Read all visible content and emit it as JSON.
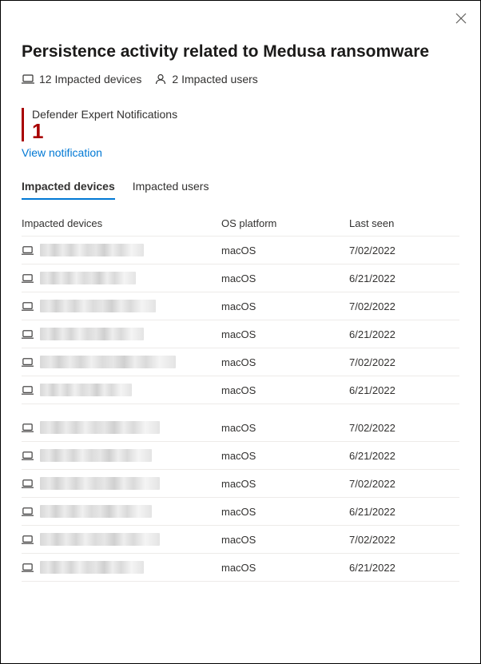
{
  "title": "Persistence activity related to Medusa ransomware",
  "summary": {
    "devices_label": "12 Impacted devices",
    "users_label": "2 Impacted users"
  },
  "notification": {
    "label": "Defender Expert Notifications",
    "count": "1",
    "view_link": "View notification"
  },
  "tabs": {
    "devices": "Impacted devices",
    "users": "Impacted users"
  },
  "columns": {
    "device": "Impacted devices",
    "os": "OS platform",
    "seen": "Last seen"
  },
  "rows": [
    {
      "os": "macOS",
      "seen": "7/02/2022",
      "w": 130
    },
    {
      "os": "macOS",
      "seen": "6/21/2022",
      "w": 120
    },
    {
      "os": "macOS",
      "seen": "7/02/2022",
      "w": 145
    },
    {
      "os": "macOS",
      "seen": "6/21/2022",
      "w": 130
    },
    {
      "os": "macOS",
      "seen": "7/02/2022",
      "w": 170
    },
    {
      "os": "macOS",
      "seen": "6/21/2022",
      "w": 115,
      "gap": true
    },
    {
      "os": "macOS",
      "seen": "7/02/2022",
      "w": 150
    },
    {
      "os": "macOS",
      "seen": "6/21/2022",
      "w": 140
    },
    {
      "os": "macOS",
      "seen": "7/02/2022",
      "w": 150
    },
    {
      "os": "macOS",
      "seen": "6/21/2022",
      "w": 140
    },
    {
      "os": "macOS",
      "seen": "7/02/2022",
      "w": 150
    },
    {
      "os": "macOS",
      "seen": "6/21/2022",
      "w": 130
    }
  ]
}
